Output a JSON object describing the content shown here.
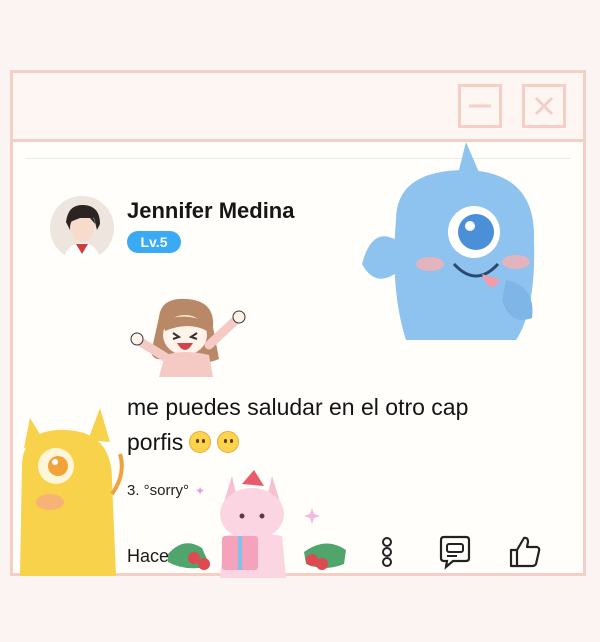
{
  "window": {
    "minimize_icon": "minimize-icon",
    "close_icon": "close-icon"
  },
  "comment": {
    "username": "Jennifer Medina",
    "level": "Lv.5",
    "message": "me puedes saludar en el otro cap porfis",
    "emojis": [
      "smiling-face-emoji",
      "smiling-face-emoji"
    ],
    "reference": "3. °sorry°",
    "timestamp": "Hace",
    "actions": {
      "more_icon": "more-vertical-icon",
      "reply_icon": "reply-icon",
      "like_icon": "thumbs-up-icon"
    }
  },
  "colors": {
    "frame": "#f5cfc6",
    "level_badge": "#3aaaf5",
    "background": "#fcf4f2"
  }
}
